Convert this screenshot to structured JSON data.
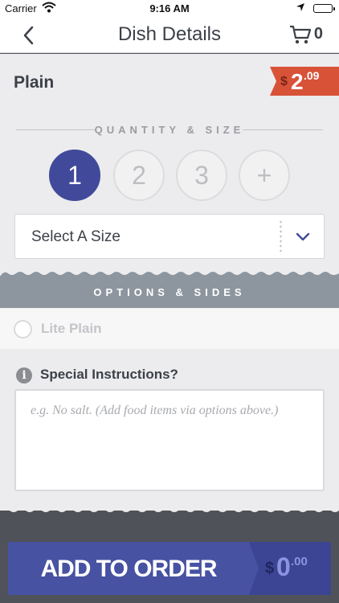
{
  "status_bar": {
    "carrier": "Carrier",
    "time": "9:16 AM"
  },
  "nav": {
    "title": "Dish Details",
    "cart_count": "0"
  },
  "dish": {
    "name": "Plain",
    "price": {
      "currency": "$",
      "whole": "2",
      "fraction": ".09"
    }
  },
  "quantity_size": {
    "label": "QUANTITY & SIZE",
    "quantities": [
      "1",
      "2",
      "3",
      "+"
    ],
    "selected": "1",
    "size_select_label": "Select A Size"
  },
  "options": {
    "label": "OPTIONS & SIDES",
    "items": [
      {
        "label": "Lite Plain",
        "checked": false
      }
    ]
  },
  "special_instructions": {
    "label": "Special Instructions?",
    "info_icon": "i",
    "placeholder": "e.g. No salt. (Add food items via options above.)",
    "value": ""
  },
  "order": {
    "button_label": "ADD TO ORDER",
    "total": {
      "currency": "$",
      "whole": "0",
      "fraction": ".00"
    }
  },
  "colors": {
    "accent": "#414a9a",
    "price_tag": "#d85238",
    "options_band": "#8d969f",
    "footer": "#4f5359"
  }
}
